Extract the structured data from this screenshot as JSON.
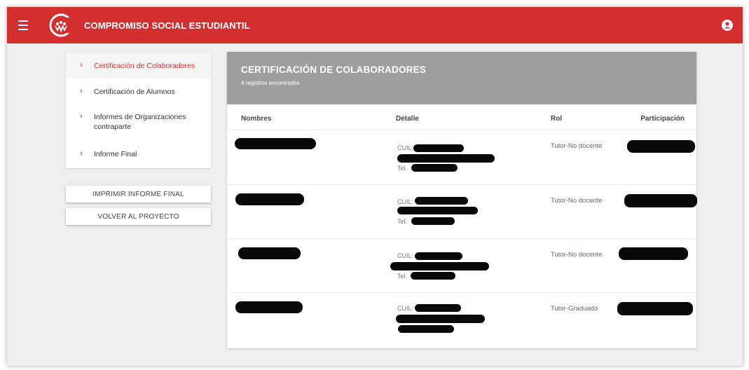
{
  "app": {
    "title": "COMPROMISO SOCIAL ESTUDIANTIL",
    "brand_color": "#d32f2f"
  },
  "sidebar": {
    "items": [
      {
        "label": "Certificación de Colaboradores",
        "active": true
      },
      {
        "label": "Certificación de Alumnos",
        "active": false
      },
      {
        "label": "Informes de Organizaciones contraparte",
        "active": false
      },
      {
        "label": "Informe Final",
        "active": false
      }
    ],
    "print_button": "IMPRIMIR INFORME FINAL",
    "back_button": "VOLVER AL PROYECTO"
  },
  "card": {
    "title": "CERTIFICACIÓN DE COLABORADORES",
    "subtitle": "4 registros encontrados",
    "header_color": "#9e9e9e"
  },
  "table": {
    "headers": {
      "nombres": "Nombres",
      "detalle": "Detalle",
      "rol": "Rol",
      "participacion": "Participación"
    },
    "cuil_label": "CUIL:",
    "tel_label": "Tel.",
    "rows": [
      {
        "rol": "Tutor-No docente"
      },
      {
        "rol": "Tutor-No docente"
      },
      {
        "rol": "Tutor-No docente"
      },
      {
        "rol": "Tutor-Graduado"
      }
    ]
  }
}
